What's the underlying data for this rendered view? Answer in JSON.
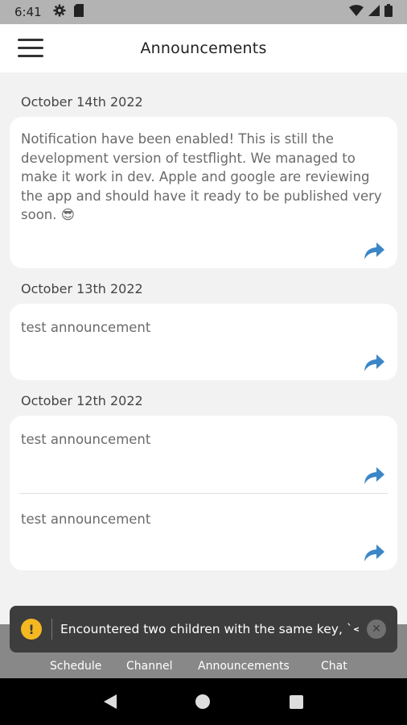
{
  "status_bar": {
    "time": "6:41",
    "icons": [
      "gear-icon",
      "sd-card-icon",
      "wifi-icon",
      "signal-icon",
      "battery-icon"
    ]
  },
  "header": {
    "title": "Announcements",
    "menu_icon": "hamburger-menu-icon"
  },
  "announcement_groups": [
    {
      "date": "October 14th 2022",
      "items": [
        {
          "text": "Notification have been enabled! This is still the development version of testflight. We managed to make it work in dev. Apple and google are reviewing the app and should have it ready to be published very soon. 😎"
        }
      ]
    },
    {
      "date": "October 13th 2022",
      "items": [
        {
          "text": "test announcement"
        }
      ]
    },
    {
      "date": "October 12th 2022",
      "items": [
        {
          "text": "test announcement"
        },
        {
          "text": "test announcement"
        }
      ]
    }
  ],
  "toast": {
    "message": "Encountered two children with the same key, `<...",
    "icon": "warning-icon",
    "close_icon": "close-icon"
  },
  "tabs": [
    {
      "label": "Schedule"
    },
    {
      "label": "Channel"
    },
    {
      "label": "Announcements",
      "active": true
    },
    {
      "label": "Chat"
    }
  ],
  "colors": {
    "accent": "#3a86c8",
    "header_bg": "#ffffff",
    "page_bg": "#f2f2f2",
    "tabbar_bg": "#888888",
    "toast_bg": "#3d3d3d",
    "warning": "#f5b820"
  }
}
